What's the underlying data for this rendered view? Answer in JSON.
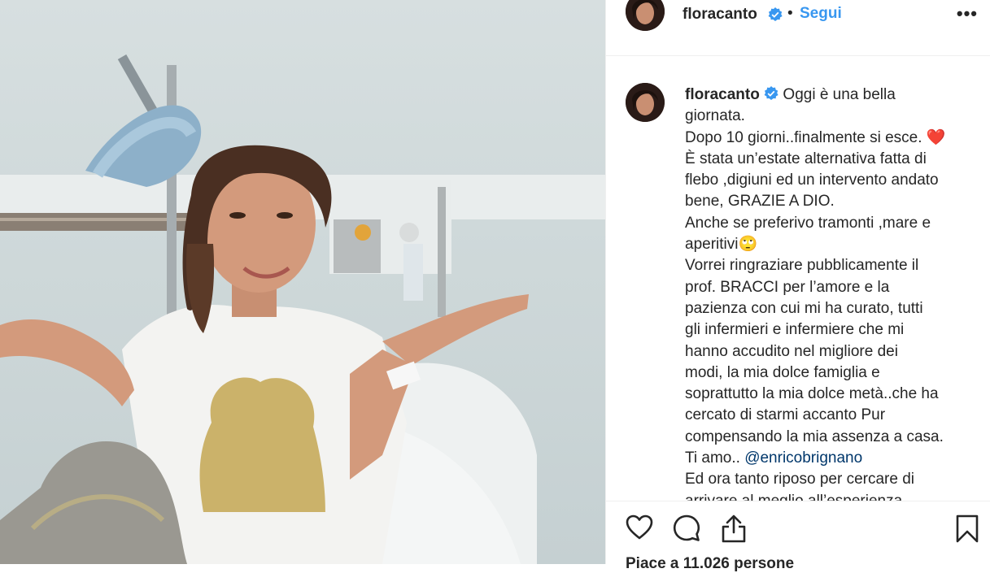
{
  "post": {
    "username": "floracanto",
    "follow_label": "Segui",
    "separator": "•",
    "more_label": "•••"
  },
  "caption": {
    "username": "floracanto",
    "lines": [
      "Oggi è una bella",
      "giornata.",
      "Dopo 10 giorni..finalmente si esce.",
      "È stata un’estate alternativa fatta di",
      "flebo ,digiuni ed un intervento andato",
      "bene, GRAZIE A DIO.",
      "Anche se preferivo tramonti ,mare e",
      "aperitivi",
      "Vorrei ringraziare pubblicamente il",
      "prof. BRACCI per l’amore e la",
      "pazienza con cui mi ha curato, tutti",
      "gli infermieri e infermiere che mi",
      "hanno accudito nel migliore dei",
      "modi, la mia dolce famiglia e",
      "soprattutto la mia dolce metà..che ha",
      "cercato di starmi accanto Pur",
      "compensando la mia assenza a casa.",
      "Ti amo..",
      "Ed ora tanto riposo per cercare di",
      "arrivare al meglio all’esperienza"
    ],
    "heart": "❤️",
    "emoji_eyeroll": "🙄",
    "mention": "@enricobrignano"
  },
  "actions": {
    "like_icon": "heart-outline-icon",
    "comment_icon": "comment-bubble-icon",
    "share_icon": "share-upload-icon",
    "save_icon": "bookmark-icon"
  },
  "likes_text": "Piace a 11.026 persone",
  "colors": {
    "link_blue": "#3897f0",
    "verified_blue": "#3897f0",
    "mention": "#00376b",
    "text": "#262626",
    "border": "#efefef"
  }
}
